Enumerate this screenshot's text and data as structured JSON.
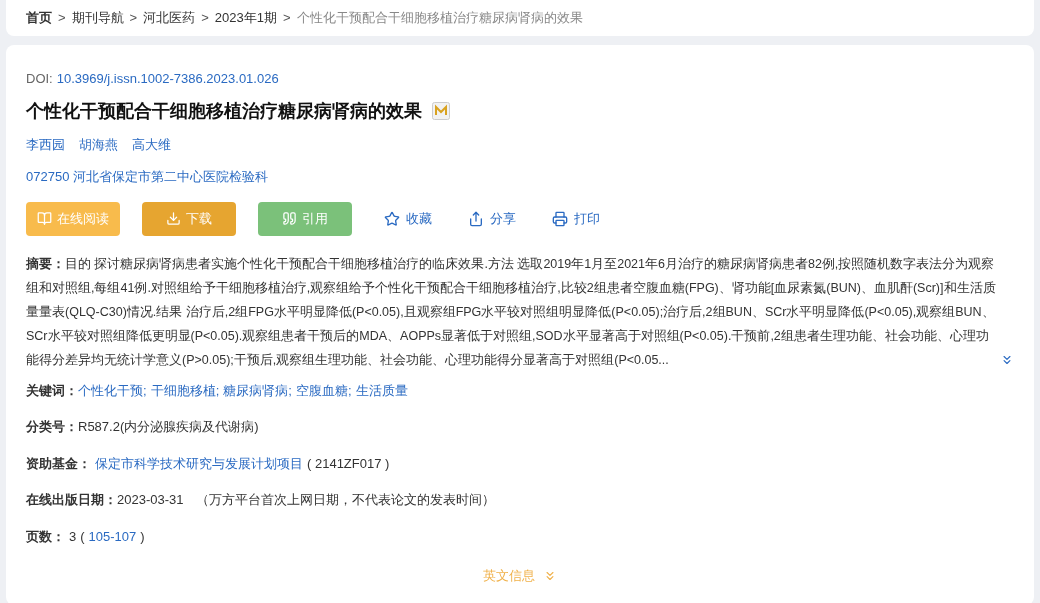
{
  "breadcrumb": [
    {
      "label": "首页",
      "current": false,
      "bold": true
    },
    {
      "label": "期刊导航",
      "current": false,
      "bold": false
    },
    {
      "label": "河北医药",
      "current": false,
      "bold": false
    },
    {
      "label": "2023年1期",
      "current": false,
      "bold": false
    },
    {
      "label": "个性化干预配合干细胞移植治疗糖尿病肾病的效果",
      "current": true,
      "bold": false
    }
  ],
  "separator": ">",
  "doi": {
    "label": "DOI:",
    "value": "10.3969/j.issn.1002-7386.2023.01.026"
  },
  "title": "个性化干预配合干细胞移植治疗糖尿病肾病的效果",
  "authors": [
    "李西园",
    "胡海燕",
    "高大维"
  ],
  "affiliation": "072750 河北省保定市第二中心医院检验科",
  "actions": [
    {
      "kind": "filled",
      "label": "在线阅读",
      "color": "#f8bb4c"
    },
    {
      "kind": "filled",
      "label": "下载",
      "color": "#e6a530"
    },
    {
      "kind": "filled",
      "label": "引用",
      "color": "#7bc17a"
    },
    {
      "kind": "link",
      "label": "收藏"
    },
    {
      "kind": "link",
      "label": "分享"
    },
    {
      "kind": "link",
      "label": "打印"
    }
  ],
  "abstract": "**摘要：**目的 探讨糖尿病肾病患者实施个性化干预配合干细胞移植治疗的临床效果.方法 选取2019年1月至2021年6月治疗的糖尿病肾病患者82例,按照随机数字表法分为观察组和对照组,每组41例.对照组给予干细胞移植治疗,观察组给予个性化干预配合干细胞移植治疗,比较2组患者空腹血糖(FPG)、肾功能[血尿素氮(BUN)、血肌酐(Scr)]和生活质量量表(QLQ-C30)情况.结果 治疗后,2组FPG水平明显降低(P<0.05),且观察组FPG水平较对照组明显降低(P<0.05);治疗后,2组BUN、SCr水平明显降低(P<0.05),观察组BUN、SCr水平较对照组降低更明显(P<0.05).观察组患者干预后的MDA、AOPPs显著低于对照组,SOD水平显著高于对照组(P<0.05).干预前,2组患者生理功能、社会功能、心理功能得分差异均无统计学意义(P>0.05);干预后,观察组生理功能、社会功能、心理功能得分显著高于对照组(P<0.05...",
  "keywords": {
    "label": "关键词：",
    "separator": ";",
    "items": [
      "个性化干预",
      "干细胞移植",
      "糖尿病肾病",
      "空腹血糖",
      "生活质量"
    ]
  },
  "classification": {
    "label": "分类号：",
    "value": "R587.2(内分泌腺疾病及代谢病)"
  },
  "fund": {
    "label": "资助基金：",
    "name": "保定市科学技术研究与发展计划项目",
    "code": "( 2141ZF017 )"
  },
  "published": {
    "label": "在线出版日期：",
    "date": "2023-03-31",
    "note": "（万方平台首次上网日期，不代表论文的发表时间）"
  },
  "pages": {
    "label": "页数：",
    "count": "3",
    "open": "(",
    "range": "105-107",
    "close": ")"
  },
  "english_info": {
    "label": "英文信息",
    "expanded": false
  }
}
